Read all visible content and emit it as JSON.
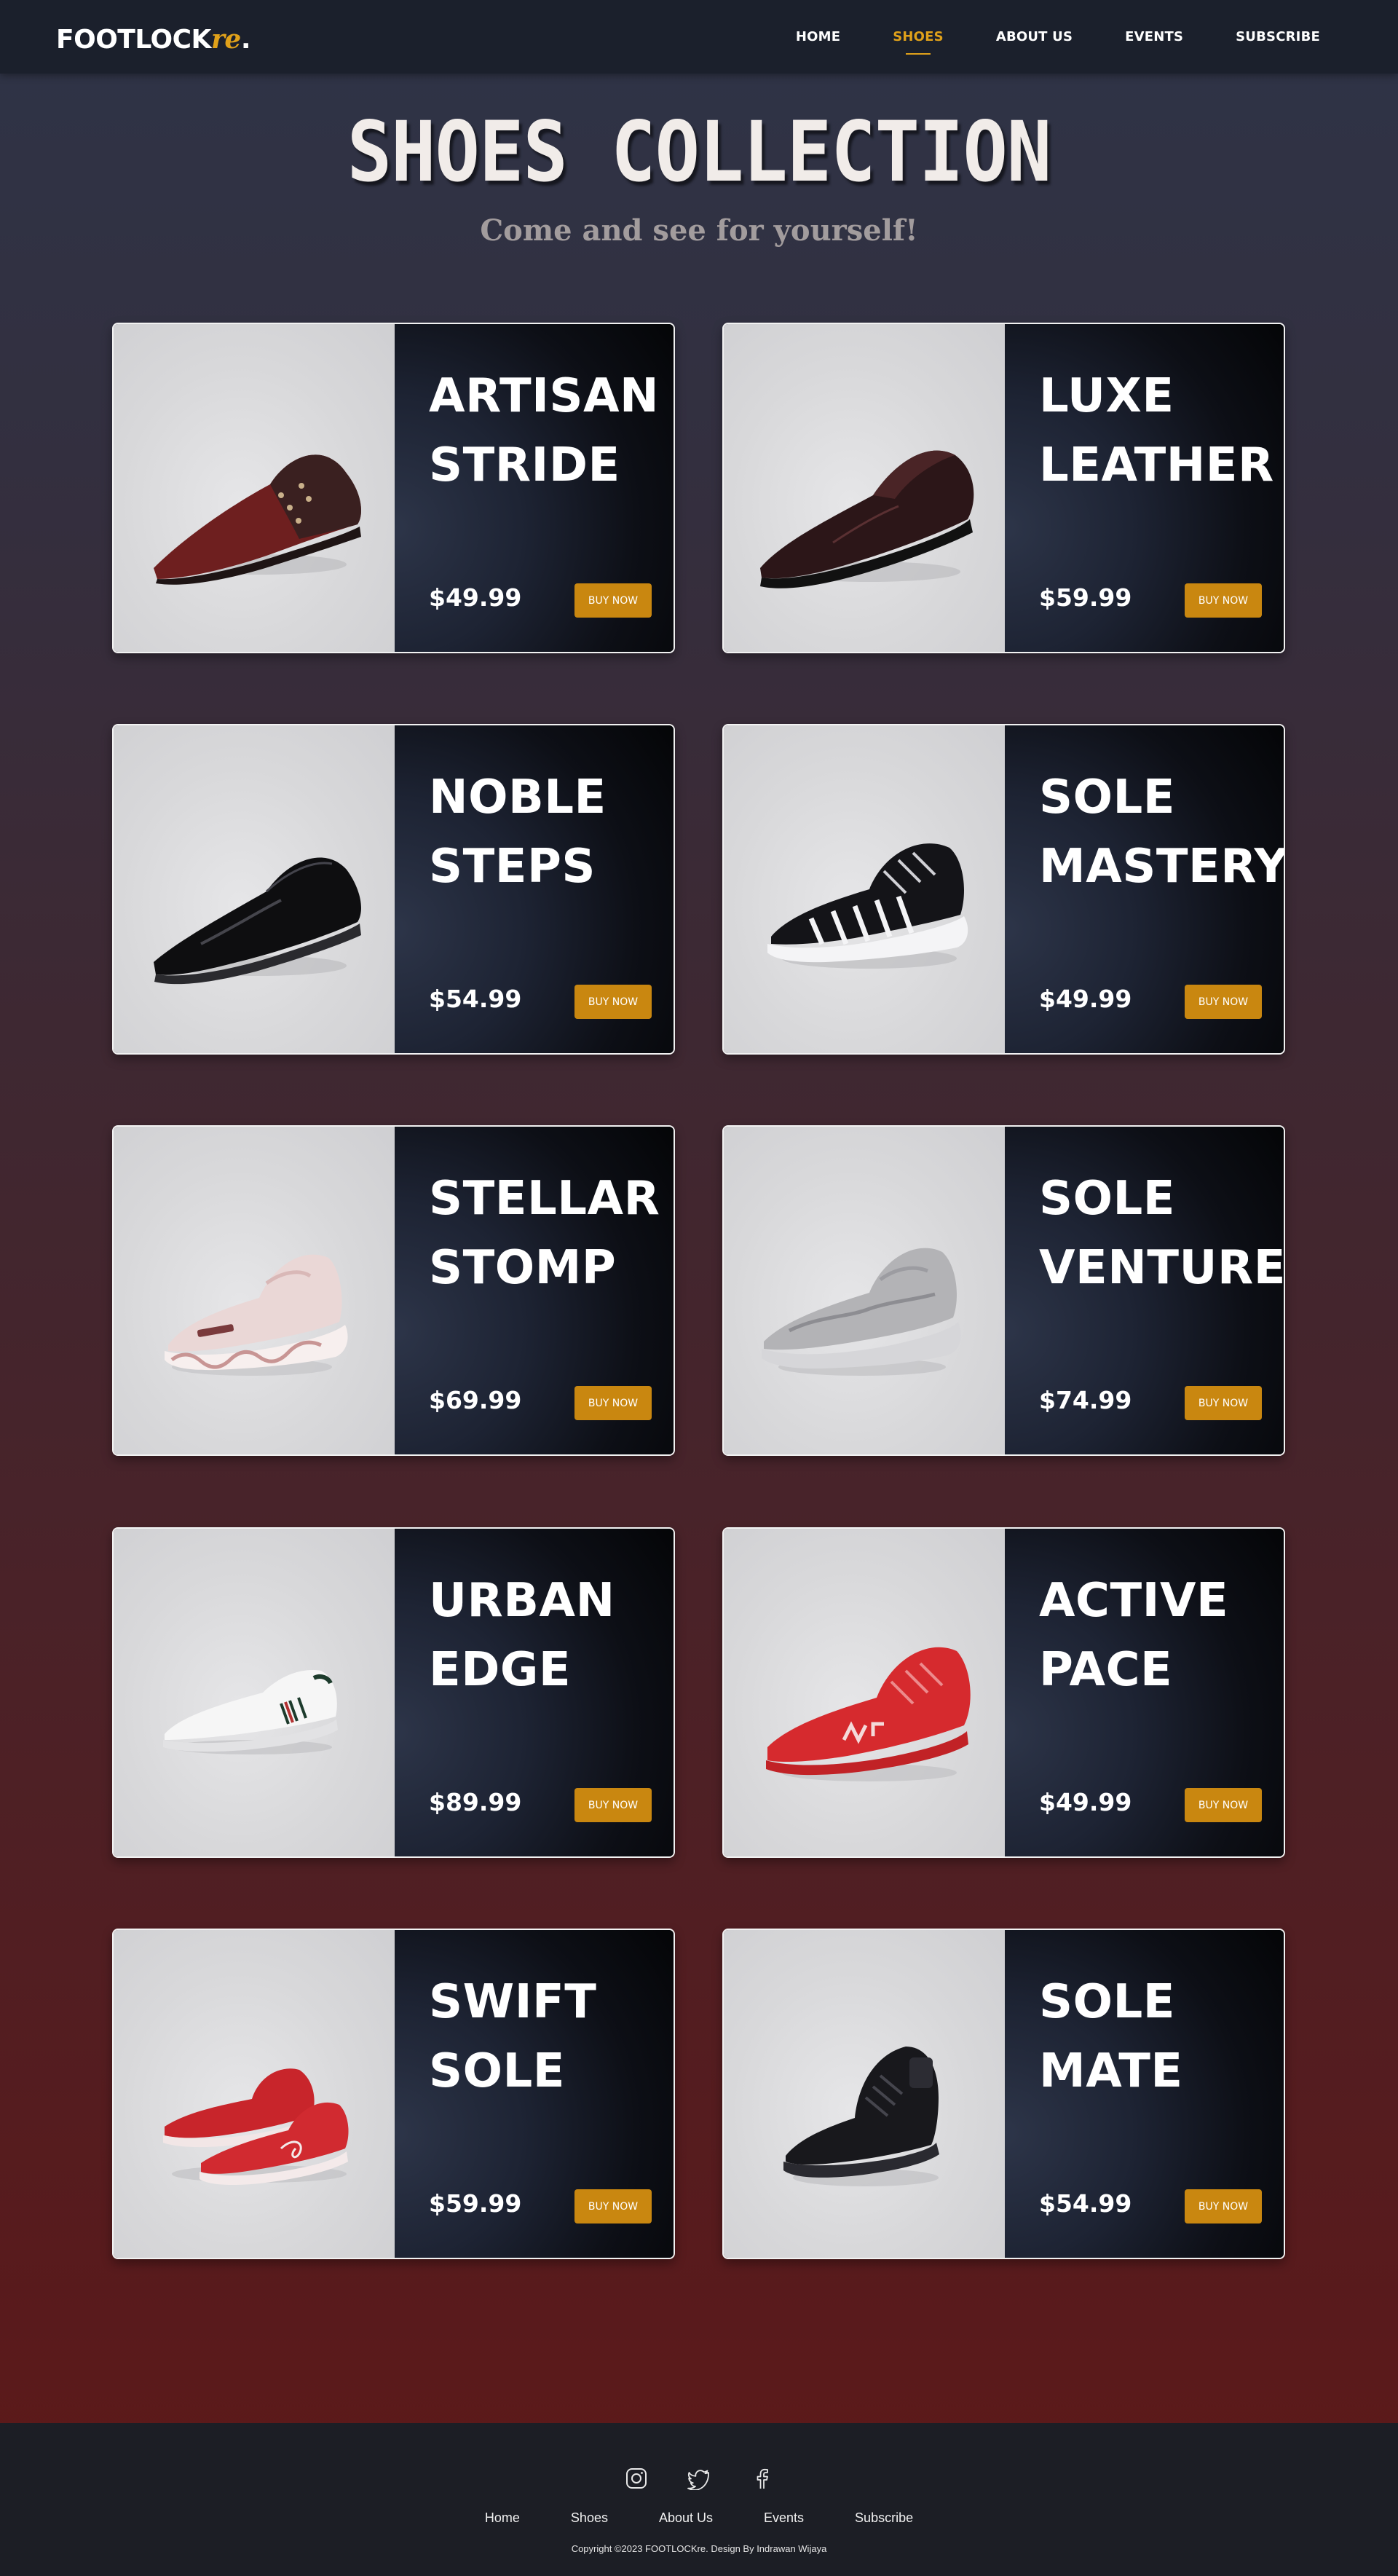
{
  "brand": {
    "logo_main": "FOOTLOCK",
    "logo_accent": "re",
    "logo_dot": "."
  },
  "nav": {
    "items": [
      {
        "label": "HOME",
        "active": false
      },
      {
        "label": "SHOES",
        "active": true
      },
      {
        "label": "ABOUT US",
        "active": false
      },
      {
        "label": "EVENTS",
        "active": false
      },
      {
        "label": "SUBSCRIBE",
        "active": false
      }
    ]
  },
  "hero": {
    "title": "SHOES COLLECTION",
    "subtitle": "Come and see for yourself!"
  },
  "products": [
    {
      "name_line1": "ARTISAN",
      "name_line2": "STRIDE",
      "price": "$49.99",
      "button": "BUY NOW",
      "image": "brown-leather-oxford-shoe"
    },
    {
      "name_line1": "LUXE",
      "name_line2": "LEATHER",
      "price": "$59.99",
      "button": "BUY NOW",
      "image": "dark-brown-loafer-shoe"
    },
    {
      "name_line1": "NOBLE",
      "name_line2": "STEPS",
      "price": "$54.99",
      "button": "BUY NOW",
      "image": "black-patent-dress-shoe"
    },
    {
      "name_line1": "SOLE",
      "name_line2": "MASTERY",
      "price": "$49.99",
      "button": "BUY NOW",
      "image": "black-white-chunky-sneaker"
    },
    {
      "name_line1": "STELLAR",
      "name_line2": "STOMP",
      "price": "$69.99",
      "button": "BUY NOW",
      "image": "pink-chunky-sneaker"
    },
    {
      "name_line1": "SOLE",
      "name_line2": "VENTURE",
      "price": "$74.99",
      "button": "BUY NOW",
      "image": "grey-chunky-sneaker"
    },
    {
      "name_line1": "URBAN",
      "name_line2": "EDGE",
      "price": "$89.99",
      "button": "BUY NOW",
      "image": "white-low-top-sneaker"
    },
    {
      "name_line1": "ACTIVE",
      "name_line2": "PACE",
      "price": "$49.99",
      "button": "BUY NOW",
      "image": "red-knit-running-shoe"
    },
    {
      "name_line1": "SWIFT",
      "name_line2": "SOLE",
      "price": "$59.99",
      "button": "BUY NOW",
      "image": "red-high-top-sneakers"
    },
    {
      "name_line1": "SOLE",
      "name_line2": "MATE",
      "price": "$54.99",
      "button": "BUY NOW",
      "image": "black-high-top-sneaker"
    }
  ],
  "footer": {
    "social": [
      "instagram-icon",
      "twitter-icon",
      "facebook-icon"
    ],
    "links": [
      "Home",
      "Shoes",
      "About Us",
      "Events",
      "Subscribe"
    ],
    "copyright": "Copyright ©2023 FOOTLOCKre. Design By Indrawan Wijaya"
  },
  "colors": {
    "accent": "#e0a11a",
    "button": "#c98710",
    "navbar": "#1b202c",
    "footer": "#1c1e25"
  }
}
